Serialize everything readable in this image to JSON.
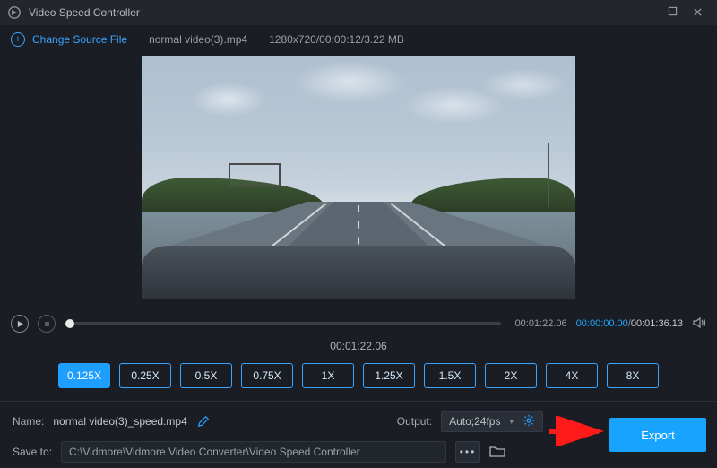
{
  "titlebar": {
    "title": "Video Speed Controller"
  },
  "subbar": {
    "change_source": "Change Source File",
    "filename": "normal video(3).mp4",
    "fileinfo": "1280x720/00:00:12/3.22 MB"
  },
  "playbar": {
    "current": "00:01:22.06",
    "start": "00:00:00.00",
    "total": "00:01:36.13"
  },
  "center_time": "00:01:22.06",
  "speeds": {
    "options": [
      "0.125X",
      "0.25X",
      "0.5X",
      "0.75X",
      "1X",
      "1.25X",
      "1.5X",
      "2X",
      "4X",
      "8X"
    ],
    "active_index": 0
  },
  "output": {
    "name_label": "Name:",
    "name_value": "normal video(3)_speed.mp4",
    "output_label": "Output:",
    "output_value": "Auto;24fps"
  },
  "save": {
    "label": "Save to:",
    "path": "C:\\Vidmore\\Vidmore Video Converter\\Video Speed Controller"
  },
  "export_label": "Export"
}
